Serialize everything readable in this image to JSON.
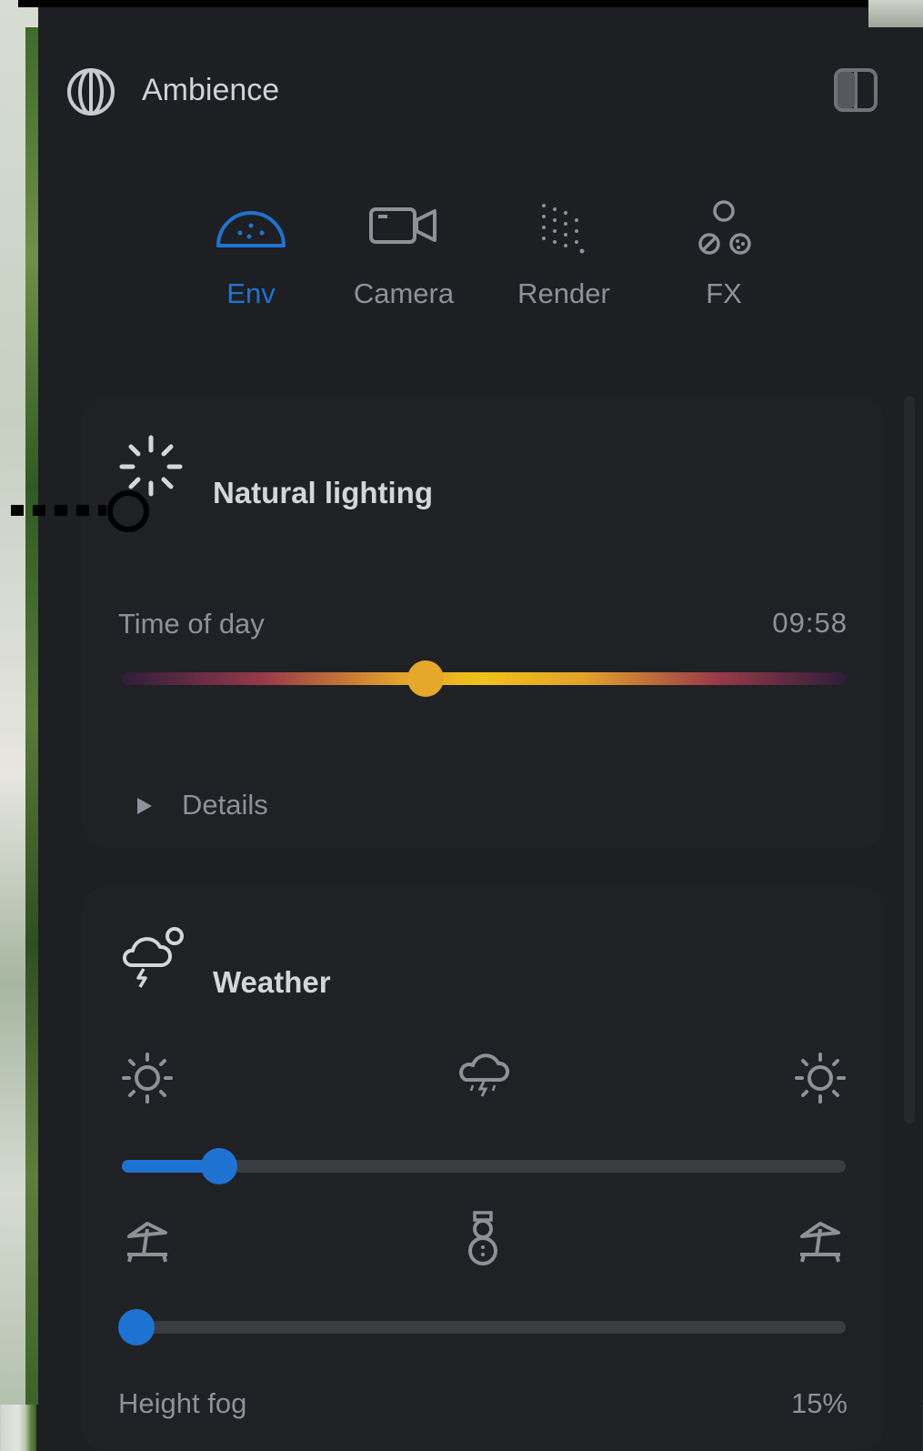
{
  "app": {
    "title": "Ambience"
  },
  "tabs": [
    {
      "label": "Env",
      "icon": "dome-icon",
      "active": true
    },
    {
      "label": "Camera",
      "icon": "camera-icon",
      "active": false
    },
    {
      "label": "Render",
      "icon": "dots-grid-icon",
      "active": false
    },
    {
      "label": "FX",
      "icon": "particles-icon",
      "active": false
    }
  ],
  "natural_lighting": {
    "title": "Natural lighting",
    "time_label": "Time of day",
    "time_value": "09:58",
    "time_fraction": 0.42,
    "details_label": "Details"
  },
  "weather": {
    "title": "Weather",
    "condition_slider_fraction": 0.135,
    "season_slider_fraction": 0.02,
    "fog_label": "Height fog",
    "fog_value": "15%"
  },
  "colors": {
    "accent": "#1e73d2",
    "thumb_time": "#e6a82a",
    "panel_bg": "#1d1f22"
  }
}
